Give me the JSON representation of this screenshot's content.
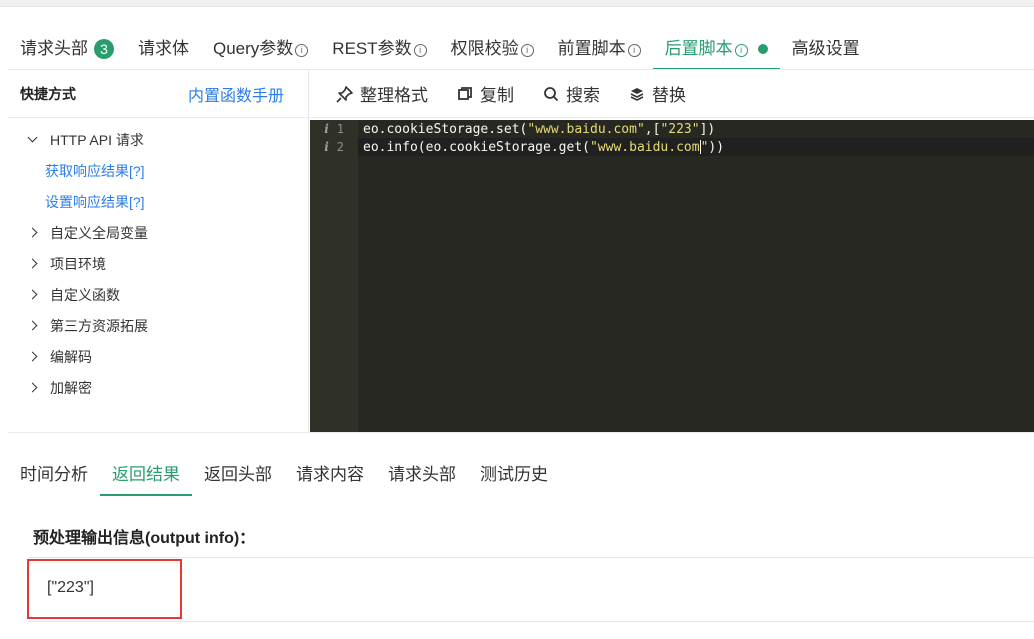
{
  "tabs": [
    {
      "label": "请求头部",
      "badge": "3"
    },
    {
      "label": "请求体"
    },
    {
      "label": "Query参数",
      "info": "i"
    },
    {
      "label": "REST参数",
      "info": "i"
    },
    {
      "label": "权限校验",
      "info": "i"
    },
    {
      "label": "前置脚本",
      "info": "i"
    },
    {
      "label": "后置脚本",
      "info": "i",
      "active": true
    },
    {
      "label": "高级设置"
    }
  ],
  "sidebar": {
    "title": "快捷方式",
    "manual_link": "内置函数手册",
    "tree": [
      {
        "label": "HTTP API 请求",
        "expanded": true,
        "children": [
          "获取响应结果[?]",
          "设置响应结果[?]"
        ]
      },
      {
        "label": "自定义全局变量"
      },
      {
        "label": "项目环境"
      },
      {
        "label": "自定义函数"
      },
      {
        "label": "第三方资源拓展"
      },
      {
        "label": "编解码"
      },
      {
        "label": "加解密"
      }
    ]
  },
  "toolbar": {
    "format": "整理格式",
    "copy": "复制",
    "search": "搜索",
    "replace": "替换"
  },
  "editor": {
    "lines": [
      {
        "num": "1",
        "pre": "eo.cookieStorage.set(",
        "s1": "\"www.baidu.com\"",
        "mid": ",[",
        "s2": "\"223\"",
        "post": "])"
      },
      {
        "num": "2",
        "pre": "eo.info(eo.cookieStorage.get(",
        "s1": "\"www.baidu.com",
        "s1b": "\"",
        "post": "))"
      }
    ]
  },
  "bottom_tabs": [
    {
      "label": "时间分析"
    },
    {
      "label": "返回结果",
      "active": true
    },
    {
      "label": "返回头部"
    },
    {
      "label": "请求内容"
    },
    {
      "label": "请求头部"
    },
    {
      "label": "测试历史"
    }
  ],
  "output": {
    "title": "预处理输出信息(output info)：",
    "value": "[\"223\"]"
  },
  "colors": {
    "accent": "#2a9d6f",
    "link": "#2b7de9",
    "highlight": "#e53935"
  }
}
